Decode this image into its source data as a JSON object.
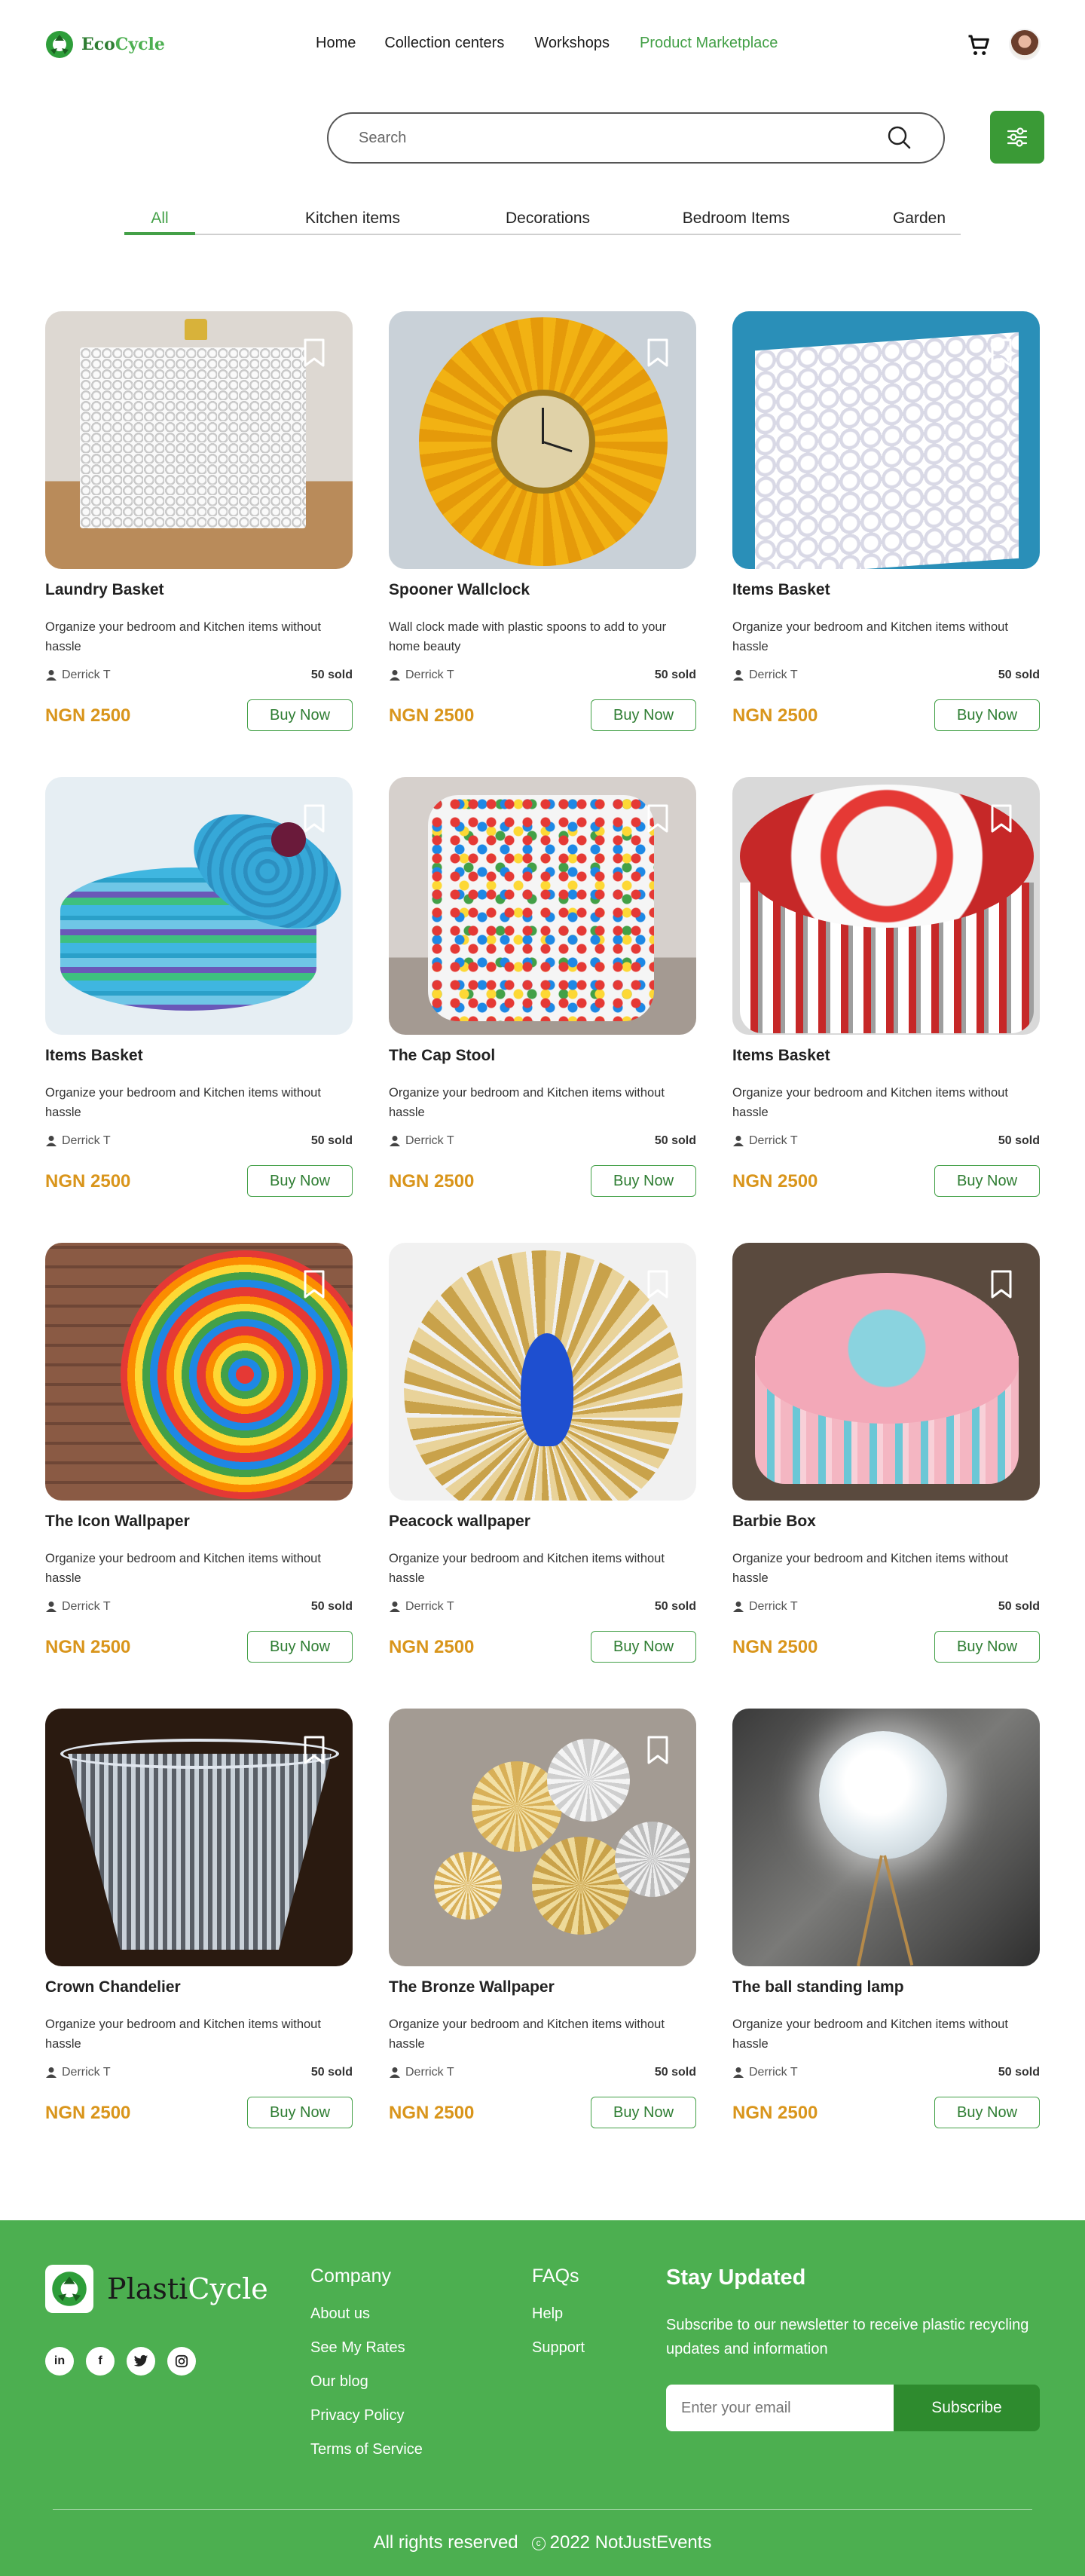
{
  "brand": {
    "part1": "Eco",
    "part2": "Cycle"
  },
  "nav": {
    "items": [
      "Home",
      "Collection centers",
      "Workshops",
      "Product Marketplace"
    ],
    "active_index": 3
  },
  "search": {
    "placeholder": "Search"
  },
  "tabs": {
    "items": [
      "All",
      "Kitchen items",
      "Decorations",
      "Bedroom Items",
      "Garden"
    ],
    "active_index": 0
  },
  "colors": {
    "brand_green": "#43a047",
    "price": "#d9951b",
    "footer_bg": "#4caf50"
  },
  "products": [
    {
      "title": "Laundry Basket",
      "desc": "Organize your bedroom and Kitchen items without hassle",
      "seller": "Derrick T",
      "sold": "50 sold",
      "price": "NGN 2500",
      "buy": "Buy Now"
    },
    {
      "title": "Spooner Wallclock",
      "desc": "Wall clock made with plastic spoons to add to your home beauty",
      "seller": "Derrick T",
      "sold": "50 sold",
      "price": "NGN 2500",
      "buy": "Buy Now"
    },
    {
      "title": "Items Basket",
      "desc": "Organize your bedroom and Kitchen items without hassle",
      "seller": "Derrick T",
      "sold": "50 sold",
      "price": "NGN 2500",
      "buy": "Buy Now"
    },
    {
      "title": "Items Basket",
      "desc": "Organize your bedroom and Kitchen items without hassle",
      "seller": "Derrick T",
      "sold": "50 sold",
      "price": "NGN 2500",
      "buy": "Buy Now"
    },
    {
      "title": "The Cap Stool",
      "desc": "Organize your bedroom and Kitchen items without hassle",
      "seller": "Derrick T",
      "sold": "50 sold",
      "price": "NGN 2500",
      "buy": "Buy Now"
    },
    {
      "title": "Items Basket",
      "desc": "Organize your bedroom and Kitchen items without hassle",
      "seller": "Derrick T",
      "sold": "50 sold",
      "price": "NGN 2500",
      "buy": "Buy Now"
    },
    {
      "title": "The Icon Wallpaper",
      "desc": "Organize your bedroom and Kitchen items without hassle",
      "seller": "Derrick T",
      "sold": "50 sold",
      "price": "NGN 2500",
      "buy": "Buy Now"
    },
    {
      "title": "Peacock wallpaper",
      "desc": "Organize your bedroom and Kitchen items without hassle",
      "seller": "Derrick T",
      "sold": "50 sold",
      "price": "NGN 2500",
      "buy": "Buy Now"
    },
    {
      "title": "Barbie Box",
      "desc": "Organize your bedroom and Kitchen items without hassle",
      "seller": "Derrick T",
      "sold": "50 sold",
      "price": "NGN 2500",
      "buy": "Buy Now"
    },
    {
      "title": "Crown Chandelier",
      "desc": "Organize your bedroom and Kitchen items without hassle",
      "seller": "Derrick T",
      "sold": "50 sold",
      "price": "NGN 2500",
      "buy": "Buy Now"
    },
    {
      "title": "The Bronze Wallpaper",
      "desc": "Organize your bedroom and Kitchen items without hassle",
      "seller": "Derrick T",
      "sold": "50 sold",
      "price": "NGN 2500",
      "buy": "Buy Now"
    },
    {
      "title": "The ball standing lamp",
      "desc": "Organize your bedroom and Kitchen items without hassle",
      "seller": "Derrick T",
      "sold": "50 sold",
      "price": "NGN 2500",
      "buy": "Buy Now"
    }
  ],
  "footer": {
    "brand": {
      "part1": "Plasti",
      "part2": "Cycle"
    },
    "socials": [
      "linkedin-icon",
      "facebook-icon",
      "twitter-icon",
      "instagram-icon"
    ],
    "company": {
      "heading": "Company",
      "links": [
        "About us",
        "See My Rates",
        "Our blog",
        "Privacy Policy",
        "Terms of Service"
      ]
    },
    "faqs": {
      "heading": "FAQs",
      "links": [
        "Help",
        "Support"
      ]
    },
    "newsletter": {
      "heading": "Stay Updated",
      "text": "Subscribe to our newsletter to receive plastic recycling updates and information",
      "placeholder": "Enter your email",
      "button": "Subscribe"
    },
    "copyright": {
      "left": "All rights reserved",
      "mark": "c",
      "right": "2022 NotJustEvents"
    }
  }
}
